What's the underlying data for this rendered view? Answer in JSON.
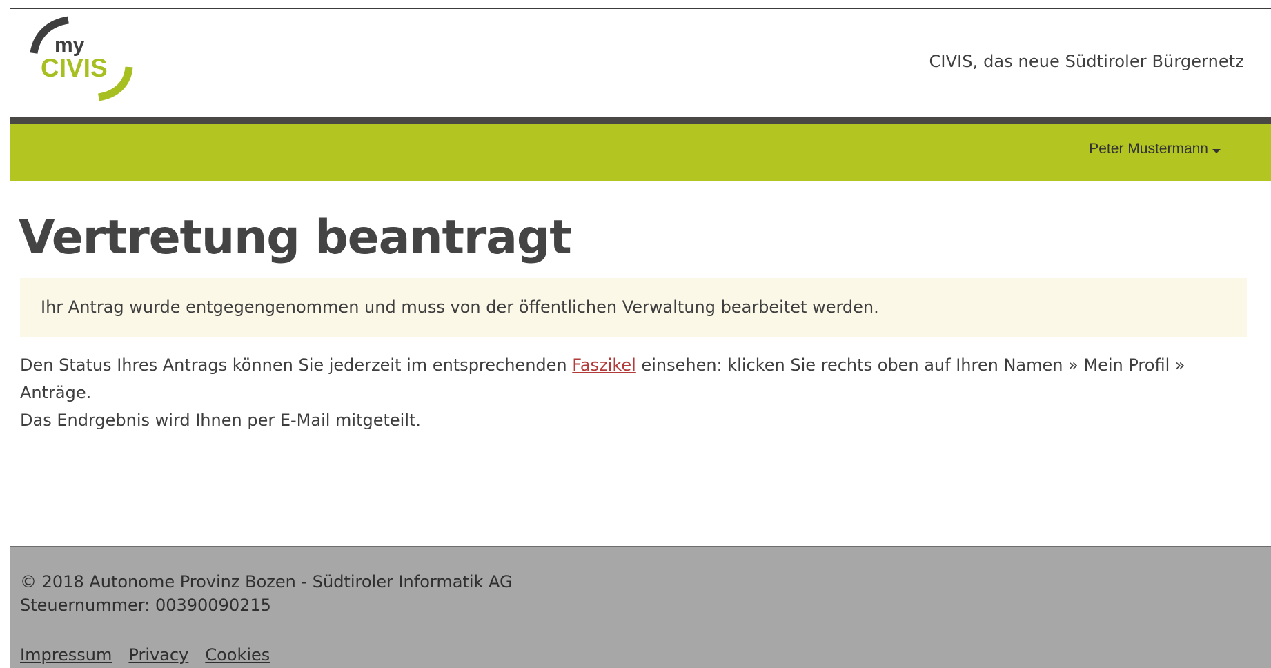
{
  "logo": {
    "line1": "my",
    "line2": "CIVIS"
  },
  "header": {
    "tagline": "CIVIS, das neue Südtiroler Bürgernetz"
  },
  "nav": {
    "user_name": "Peter Mustermann"
  },
  "main": {
    "title": "Vertretung beantragt",
    "alert": "Ihr Antrag wurde entgegengenommen und muss von der öffentlichen Verwaltung bearbeitet werden.",
    "status_prefix": "Den Status Ihres Antrags können Sie jederzeit im entsprechenden ",
    "status_link": "Faszikel",
    "status_suffix": " einsehen: klicken Sie rechts oben auf Ihren Namen  »  Mein Profil  »  Anträge.",
    "result_text": "Das Endrgebnis wird Ihnen per E-Mail mitgeteilt."
  },
  "footer": {
    "copyright": "© 2018 Autonome Provinz Bozen - Südtiroler Informatik AG",
    "tax_number": "Steuernummer: 00390090215",
    "links": [
      "Impressum",
      "Privacy",
      "Cookies"
    ]
  },
  "colors": {
    "brand_green": "#b3c520",
    "dark_bar": "#4a4845",
    "alert_bg": "#fcf8e8",
    "footer_bg": "#a7a7a7",
    "link_red": "#b23a3a"
  }
}
